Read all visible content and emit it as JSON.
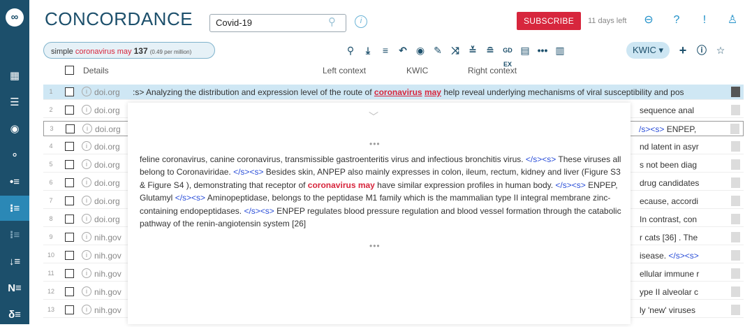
{
  "app": {
    "title": "CONCORDANCE",
    "logo": "Sketch Engine logo"
  },
  "search": {
    "value": "Covid-19",
    "icon": "search-icon"
  },
  "header": {
    "subscribe_label": "SUBSCRIBE",
    "days_left": "11 days left"
  },
  "sidebar": {
    "items": [
      {
        "icon": "dashboard-icon"
      },
      {
        "icon": "menu-icon"
      },
      {
        "icon": "target-icon"
      },
      {
        "icon": "filter-icon"
      },
      {
        "icon": "list-icon"
      },
      {
        "icon": "concordance-icon",
        "active": true
      },
      {
        "icon": "concordance-parallel-icon"
      },
      {
        "icon": "sort-list-icon"
      },
      {
        "icon": "ngram-icon"
      },
      {
        "icon": "keywords-icon"
      }
    ]
  },
  "query": {
    "type": "simple",
    "keyword": "coronavirus may",
    "count": "137",
    "per_million": "(0.49 per million)"
  },
  "toolbar": {
    "view_mode": "KWIC ▾"
  },
  "columns": {
    "details": "Details",
    "left_context": "Left context",
    "kwic": "KWIC",
    "right_context": "Right context"
  },
  "rows": [
    {
      "num": "1",
      "source": "doi.org",
      "left": ":s> Analyzing the distribution and expression level of the route of",
      "kwic1": "coronavirus",
      "kwic2": "may",
      "right": "help reveal underlying mechanisms of viral susceptibility and pos"
    },
    {
      "num": "2",
      "source": "doi.org",
      "right": "sequence anal"
    },
    {
      "num": "3",
      "source": "doi.org",
      "right_tag": "/s><s>",
      "right": " ENPEP,"
    },
    {
      "num": "4",
      "source": "doi.org",
      "right": "nd latent in asyr"
    },
    {
      "num": "5",
      "source": "doi.org",
      "right": "s not been diag"
    },
    {
      "num": "6",
      "source": "doi.org",
      "right": "drug candidates"
    },
    {
      "num": "7",
      "source": "doi.org",
      "right": "ecause, accordi"
    },
    {
      "num": "8",
      "source": "doi.org",
      "right": "In contrast, con"
    },
    {
      "num": "9",
      "source": "nih.gov",
      "right": "r cats [36] . The"
    },
    {
      "num": "10",
      "source": "nih.gov",
      "right": "isease. ",
      "right_tag": "</s><s>"
    },
    {
      "num": "11",
      "source": "nih.gov",
      "right": "ellular immune r"
    },
    {
      "num": "12",
      "source": "nih.gov",
      "right": "ype II alveolar c"
    },
    {
      "num": "13",
      "source": "nih.gov",
      "right": "ly 'new' viruses"
    }
  ],
  "popup": {
    "dots_top": "•••",
    "dots_bottom": "•••",
    "t1": "feline coronavirus, canine coronavirus, transmissible gastroenteritis virus and infectious bronchitis virus. ",
    "tag1": "</s><s>",
    "t2": " These viruses all belong to Coronaviridae. ",
    "tag2": "</s><s>",
    "t3": " Besides skin, ANPEP also mainly expresses in colon, ileum, rectum, kidney and liver (Figure S3 & Figure S4 ), demonstrating that receptor of ",
    "kw": "coronavirus may",
    "t4": " have similar expression profiles in human body. ",
    "tag3": "</s><s>",
    "t5": " ENPEP, Glutamyl ",
    "tag4": "</s><s>",
    "t6": " Aminopeptidase, belongs to the peptidase M1 family which is the mammalian type II integral membrane zinc-containing endopeptidases. ",
    "tag5": "</s><s>",
    "t7": " ENPEP regulates blood pressure regulation and blood vessel formation through the catabolic pathway of the renin-angiotensin system [26]"
  },
  "colors": {
    "sidebar": "#1c4f6b",
    "accent": "#2b88b6",
    "keyword": "#d7263d",
    "tag": "#2a4ed8",
    "subscribe": "#d7263d"
  }
}
